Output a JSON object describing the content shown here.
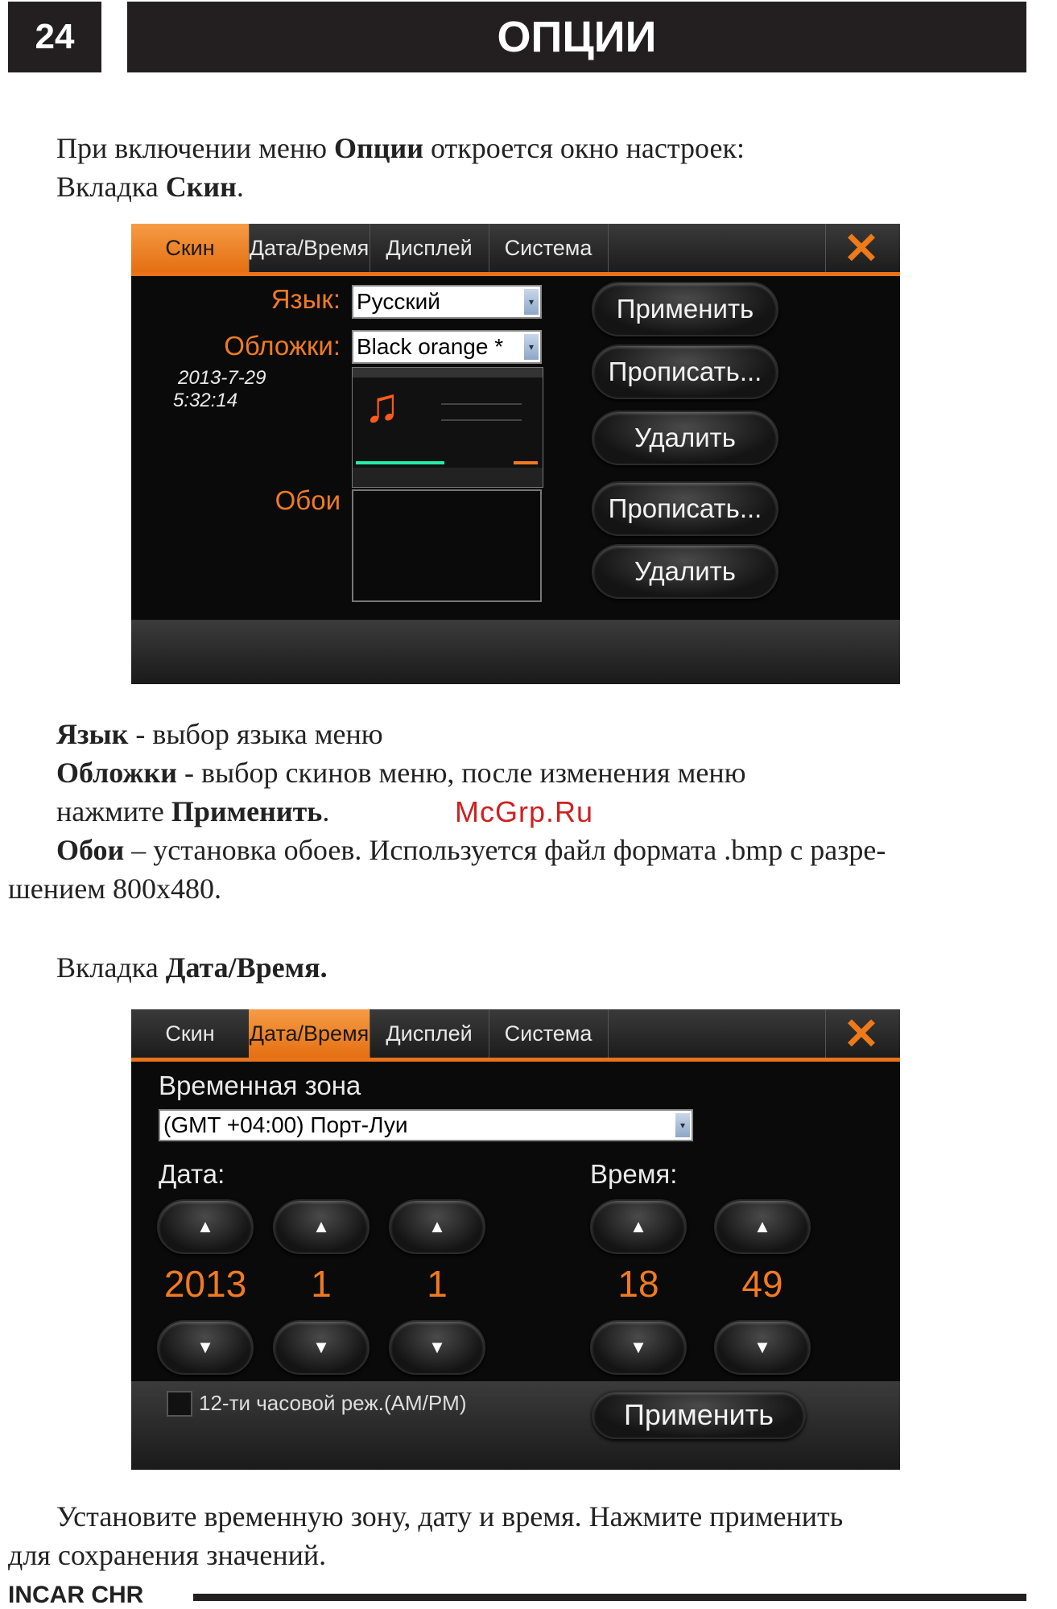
{
  "header": {
    "page_number": "24",
    "title": "ОПЦИИ"
  },
  "intro": {
    "line1_a": "При включении меню ",
    "line1_b": "Опции",
    "line1_c": "  откроется окно настроек:",
    "line2_a": "Вкладка ",
    "line2_b": "Скин",
    "line2_c": "."
  },
  "tabs": [
    "Скин",
    "Дата/Время",
    "Дисплей",
    "Система"
  ],
  "close_glyph": "✕",
  "skin_screen": {
    "active_tab": 0,
    "language_label": "Язык:",
    "language_value": "Русский",
    "skins_label": "Обложки:",
    "skins_value": "Black orange *",
    "date": "2013-7-29",
    "time": "5:32:14",
    "wallpaper_label": "Обои",
    "buttons": {
      "apply": "Применить",
      "register1": "Прописать...",
      "delete1": "Удалить",
      "register2": "Прописать...",
      "delete2": "Удалить"
    }
  },
  "description": {
    "lang_term": "Язык",
    "lang_text": " - выбор языка меню",
    "skins_term": "Обложки",
    "skins_text": " - выбор скинов меню, после изменения меню",
    "skins_line2_a": "нажмите ",
    "skins_line2_b": "Применить",
    "skins_line2_c": ".",
    "wall_term": "Обои",
    "wall_text": " – установка обоев. Используется файл  формата .bmp с разре-",
    "wall_line2": "шением 800x480."
  },
  "watermark": "McGrp.Ru",
  "datetime_intro": {
    "a": "Вкладка  ",
    "b": "Дата/Время."
  },
  "datetime_screen": {
    "active_tab": 1,
    "timezone_label": "Временная зона",
    "timezone_value": "(GMT +04:00) Порт-Луи",
    "date_label": "Дата:",
    "time_label": "Время:",
    "year": "2013",
    "month": "1",
    "day": "1",
    "hour": "18",
    "minute": "49",
    "up_glyph": "▲",
    "down_glyph": "▼",
    "ampm_label": "12-ти часовой реж.(AM/PM)",
    "apply": "Применить"
  },
  "outro": {
    "line1": "Установите  временную  зону,  дату  и  время.  Нажмите  применить",
    "line2": "для сохранения значений."
  },
  "footer": {
    "brand": "INCAR CHR"
  }
}
